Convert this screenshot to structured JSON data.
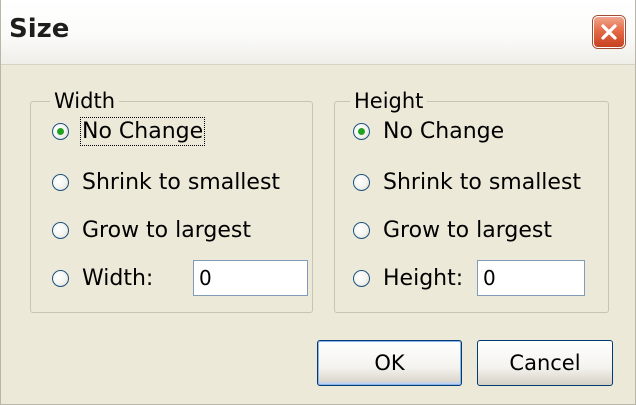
{
  "dialog": {
    "title": "Size",
    "close_icon": "close-icon"
  },
  "width_group": {
    "legend": "Width",
    "options": [
      {
        "label": "No Change",
        "selected": true
      },
      {
        "label": "Shrink to smallest",
        "selected": false
      },
      {
        "label": "Grow to largest",
        "selected": false
      },
      {
        "label": "Width:",
        "selected": false
      }
    ],
    "value": "0"
  },
  "height_group": {
    "legend": "Height",
    "options": [
      {
        "label": "No Change",
        "selected": true
      },
      {
        "label": "Shrink to smallest",
        "selected": false
      },
      {
        "label": "Grow to largest",
        "selected": false
      },
      {
        "label": "Height:",
        "selected": false
      }
    ],
    "value": "0"
  },
  "buttons": {
    "ok": "OK",
    "cancel": "Cancel"
  }
}
